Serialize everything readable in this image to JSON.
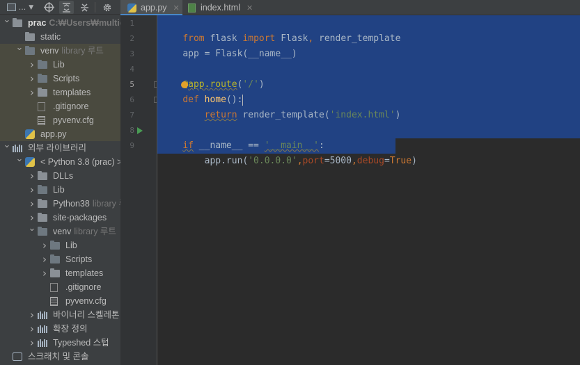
{
  "toolbar": {
    "view_dropdown": "...",
    "icons": [
      "project-view-icon",
      "locate-icon",
      "expand-all-icon",
      "collapse-all-icon",
      "settings-gear-icon"
    ]
  },
  "tabs": [
    {
      "label": "app.py",
      "active": true
    },
    {
      "label": "index.html",
      "active": false
    }
  ],
  "tree": [
    {
      "indent": 0,
      "arrow": "down",
      "icon": "folder",
      "label": "prac",
      "sub": "C:₩Users₩multicam",
      "bold": true
    },
    {
      "indent": 1,
      "arrow": "none",
      "icon": "folder",
      "label": "static",
      "sub": ""
    },
    {
      "indent": 1,
      "arrow": "down",
      "icon": "folder",
      "label": "venv",
      "sub": "library 루트"
    },
    {
      "indent": 2,
      "arrow": "right",
      "icon": "folder",
      "label": "Lib",
      "sub": ""
    },
    {
      "indent": 2,
      "arrow": "right",
      "icon": "folder",
      "label": "Scripts",
      "sub": ""
    },
    {
      "indent": 2,
      "arrow": "right",
      "icon": "folder",
      "label": "templates",
      "sub": ""
    },
    {
      "indent": 2,
      "arrow": "none",
      "icon": "gitignore",
      "label": ".gitignore",
      "sub": ""
    },
    {
      "indent": 2,
      "arrow": "none",
      "icon": "cfg",
      "label": "pyvenv.cfg",
      "sub": ""
    },
    {
      "indent": 1,
      "arrow": "none",
      "icon": "python",
      "label": "app.py",
      "sub": ""
    },
    {
      "indent": 0,
      "arrow": "down",
      "icon": "library",
      "label": "외부 라이브러리",
      "sub": ""
    },
    {
      "indent": 1,
      "arrow": "down",
      "icon": "python",
      "label": "< Python 3.8 (prac) >",
      "sub": ""
    },
    {
      "indent": 2,
      "arrow": "right",
      "icon": "folder",
      "label": "DLLs",
      "sub": ""
    },
    {
      "indent": 2,
      "arrow": "right",
      "icon": "folder",
      "label": "Lib",
      "sub": ""
    },
    {
      "indent": 2,
      "arrow": "right",
      "icon": "folder",
      "label": "Python38",
      "sub": "library 루"
    },
    {
      "indent": 2,
      "arrow": "right",
      "icon": "folder",
      "label": "site-packages",
      "sub": ""
    },
    {
      "indent": 2,
      "arrow": "down",
      "icon": "folder",
      "label": "venv",
      "sub": "library 루트"
    },
    {
      "indent": 3,
      "arrow": "right",
      "icon": "folder",
      "label": "Lib",
      "sub": ""
    },
    {
      "indent": 3,
      "arrow": "right",
      "icon": "folder",
      "label": "Scripts",
      "sub": ""
    },
    {
      "indent": 3,
      "arrow": "right",
      "icon": "folder",
      "label": "templates",
      "sub": ""
    },
    {
      "indent": 3,
      "arrow": "none",
      "icon": "gitignore",
      "label": ".gitignore",
      "sub": ""
    },
    {
      "indent": 3,
      "arrow": "none",
      "icon": "cfg",
      "label": "pyvenv.cfg",
      "sub": ""
    },
    {
      "indent": 2,
      "arrow": "right",
      "icon": "library",
      "label": "바이너리 스켈레톤",
      "sub": ""
    },
    {
      "indent": 2,
      "arrow": "right",
      "icon": "library",
      "label": "확장 정의",
      "sub": ""
    },
    {
      "indent": 2,
      "arrow": "right",
      "icon": "library",
      "label": "Typeshed 스텁",
      "sub": ""
    },
    {
      "indent": 0,
      "arrow": "none",
      "icon": "scratch",
      "label": "스크래치 및 콘솔",
      "sub": ""
    }
  ],
  "line_numbers": [
    "1",
    "2",
    "3",
    "4",
    "5",
    "6",
    "7",
    "8",
    "9"
  ],
  "code": {
    "l1": [
      "from",
      " flask ",
      "import",
      " Flask",
      ",",
      " render_template"
    ],
    "l2": [
      "app = Flask(__name__)"
    ],
    "l4": [
      "@",
      "app.route",
      "(",
      "'/'",
      ")"
    ],
    "l5": [
      "def",
      " ",
      "home",
      "():"
    ],
    "l6": [
      "    ",
      "return",
      " render_template(",
      "'index.html'",
      ")"
    ],
    "l8": [
      "if",
      " __name__ == ",
      "'__main__'",
      ":"
    ],
    "l9": [
      "    app.run(",
      "'0.0.0.0'",
      ",",
      "port",
      "=5000",
      ",",
      "debug",
      "=",
      "True",
      ")"
    ]
  },
  "colors": {
    "selection": "#214283",
    "keyword": "#cc7832",
    "string": "#6a8759",
    "function": "#ffc66d",
    "decorator": "#bbb529",
    "param": "#aa4926",
    "run": "#499c54"
  }
}
